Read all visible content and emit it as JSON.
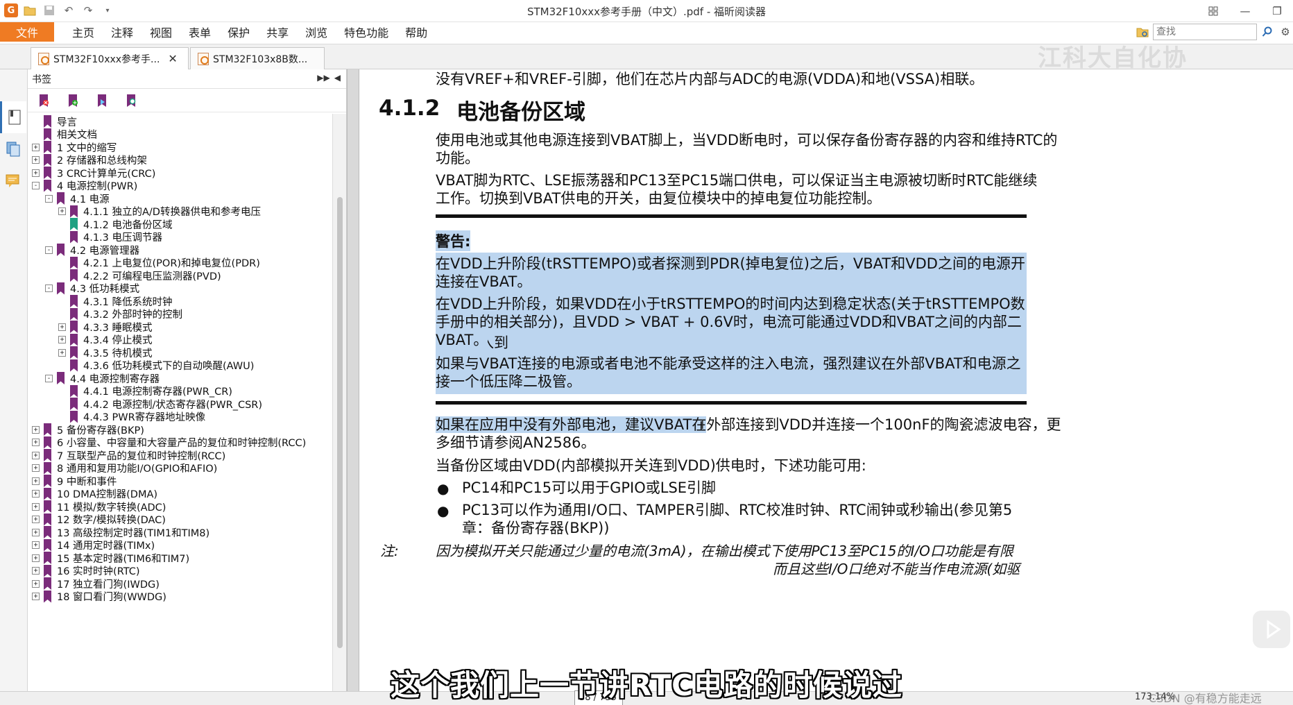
{
  "window": {
    "title": "STM32F10xxx参考手册（中文）.pdf - 福昕阅读器",
    "watermark": "江科大自化协"
  },
  "quick_access": {
    "icons": [
      "app-icon",
      "open-icon",
      "save-icon",
      "undo-icon",
      "redo-icon",
      "customize-icon"
    ]
  },
  "menubar": {
    "file_label": "文件",
    "items": [
      "主页",
      "注释",
      "视图",
      "表单",
      "保护",
      "共享",
      "浏览",
      "特色功能",
      "帮助"
    ],
    "search_placeholder": "查找"
  },
  "tabs": [
    {
      "label": "STM32F10xxx参考手...",
      "active": true
    },
    {
      "label": "STM32F103x8B数...",
      "active": false
    }
  ],
  "bookmarks": {
    "header": "书签",
    "items": [
      {
        "text": "导言",
        "level": 0,
        "toggle": ""
      },
      {
        "text": "相关文档",
        "level": 0,
        "toggle": ""
      },
      {
        "text": "1 文中的缩写",
        "level": 0,
        "toggle": "+"
      },
      {
        "text": "2 存储器和总线构架",
        "level": 0,
        "toggle": "+"
      },
      {
        "text": "3 CRC计算单元(CRC)",
        "level": 0,
        "toggle": "+"
      },
      {
        "text": "4 电源控制(PWR)",
        "level": 0,
        "toggle": "-"
      },
      {
        "text": "4.1 电源",
        "level": 1,
        "toggle": "-"
      },
      {
        "text": "4.1.1 独立的A/D转换器供电和参考电压",
        "level": 2,
        "toggle": "+"
      },
      {
        "text": "4.1.2 电池备份区域",
        "level": 2,
        "toggle": "",
        "current": true
      },
      {
        "text": "4.1.3 电压调节器",
        "level": 2,
        "toggle": ""
      },
      {
        "text": "4.2 电源管理器",
        "level": 1,
        "toggle": "-"
      },
      {
        "text": "4.2.1 上电复位(POR)和掉电复位(PDR)",
        "level": 2,
        "toggle": ""
      },
      {
        "text": "4.2.2 可编程电压监测器(PVD)",
        "level": 2,
        "toggle": ""
      },
      {
        "text": "4.3 低功耗模式",
        "level": 1,
        "toggle": "-"
      },
      {
        "text": "4.3.1 降低系统时钟",
        "level": 2,
        "toggle": ""
      },
      {
        "text": "4.3.2 外部时钟的控制",
        "level": 2,
        "toggle": ""
      },
      {
        "text": "4.3.3 睡眠模式",
        "level": 2,
        "toggle": "+"
      },
      {
        "text": "4.3.4 停止模式",
        "level": 2,
        "toggle": "+"
      },
      {
        "text": "4.3.5 待机模式",
        "level": 2,
        "toggle": "+"
      },
      {
        "text": "4.3.6 低功耗模式下的自动唤醒(AWU)",
        "level": 2,
        "toggle": ""
      },
      {
        "text": "4.4 电源控制寄存器",
        "level": 1,
        "toggle": "-"
      },
      {
        "text": "4.4.1 电源控制寄存器(PWR_CR)",
        "level": 2,
        "toggle": ""
      },
      {
        "text": "4.4.2 电源控制/状态寄存器(PWR_CSR)",
        "level": 2,
        "toggle": ""
      },
      {
        "text": "4.4.3 PWR寄存器地址映像",
        "level": 2,
        "toggle": ""
      },
      {
        "text": "5 备份寄存器(BKP)",
        "level": 0,
        "toggle": "+"
      },
      {
        "text": "6 小容量、中容量和大容量产品的复位和时钟控制(RCC)",
        "level": 0,
        "toggle": "+"
      },
      {
        "text": "7 互联型产品的复位和时钟控制(RCC)",
        "level": 0,
        "toggle": "+"
      },
      {
        "text": "8 通用和复用功能I/O(GPIO和AFIO)",
        "level": 0,
        "toggle": "+"
      },
      {
        "text": "9 中断和事件",
        "level": 0,
        "toggle": "+"
      },
      {
        "text": "10 DMA控制器(DMA)",
        "level": 0,
        "toggle": "+"
      },
      {
        "text": "11 模拟/数字转换(ADC)",
        "level": 0,
        "toggle": "+"
      },
      {
        "text": "12 数字/模拟转换(DAC)",
        "level": 0,
        "toggle": "+"
      },
      {
        "text": "13 高级控制定时器(TIM1和TIM8)",
        "level": 0,
        "toggle": "+"
      },
      {
        "text": "14 通用定时器(TIMx)",
        "level": 0,
        "toggle": "+"
      },
      {
        "text": "15 基本定时器(TIM6和TIM7)",
        "level": 0,
        "toggle": "+"
      },
      {
        "text": "16 实时时钟(RTC)",
        "level": 0,
        "toggle": "+"
      },
      {
        "text": "17 独立看门狗(IWDG)",
        "level": 0,
        "toggle": "+"
      },
      {
        "text": "18 窗口看门狗(WWDG)",
        "level": 0,
        "toggle": "+"
      }
    ]
  },
  "document": {
    "top_line": "没有VREF+和VREF-引脚，他们在芯片内部与ADC的电源(VDDA)和地(VSSA)相联。",
    "section_number": "4.1.2",
    "section_title": "电池备份区域",
    "para1_a": "使用电池或其他电源连接到VBAT脚上，当VDD断电时，可以保存备份寄存器的内容和维持RTC的",
    "para1_b": "功能。",
    "para2_a": "VBAT脚为RTC、LSE振荡器和PC13至PC15端口供电，可以保证当主电源被切断时RTC能继续",
    "para2_b": "工作。切换到VBAT供电的开关，由复位模块中的掉电复位功能控制。",
    "warning_title": "警告:",
    "warn1_a": "在VDD上升阶段(tRSTTEMPO)或者探测到PDR(掉电复位)之后，VBAT和VDD之间的电源开关仍会保持",
    "warn1_b": "连接在VBAT。",
    "warn2_a": "在VDD上升阶段，如果VDD在小于tRSTTEMPO的时间内达到稳定状态(关于tRSTTEMPO数值可参考数据",
    "warn2_b": "手册中的相关部分)，且VDD > VBAT + 0.6V时，电流可能通过VDD和VBAT之间的内部二极管注入到",
    "warn2_c": "VBAT。",
    "warn3_a": "如果与VBAT连接的电源或者电池不能承受这样的注入电流，强烈建议在外部VBAT和电源之间连",
    "warn3_b": "接一个低压降二极管。",
    "para3_hl": "如果在应用中没有外部电池，建议VBAT在",
    "para3_rest": "外部连接到VDD并连接一个100nF的陶瓷滤波电容，更",
    "para3_b": "多细节请参阅AN2586。",
    "para4": "当备份区域由VDD(内部模拟开关连到VDD)供电时，下述功能可用:",
    "bullet1": "PC14和PC15可以用于GPIO或LSE引脚",
    "bullet2_a": "PC13可以作为通用I/O口、TAMPER引脚、RTC校准时钟、RTC闹钟或秒输出(参见第5",
    "bullet2_b": "章：备份寄存器(BKP))",
    "note_label": "注:",
    "note_a": "因为模拟开关只能通过少量的电流(3mA)，在输出模式下使用PC13至PC15的I/O口功能是有限",
    "note_b": "而且这些I/O口绝对不能当作电流源(如驱"
  },
  "status": {
    "page": "38 / 755",
    "zoom": "173.14%",
    "csdn": "CSDN @有稳方能走远"
  },
  "subtitle": "这个我们上一节讲RTC电路的时候说过",
  "colors": {
    "accent": "#ef7b23",
    "highlight": "#bcd5ef",
    "bookmark": "#7b2c7b",
    "bookmark_current": "#1ea182"
  }
}
